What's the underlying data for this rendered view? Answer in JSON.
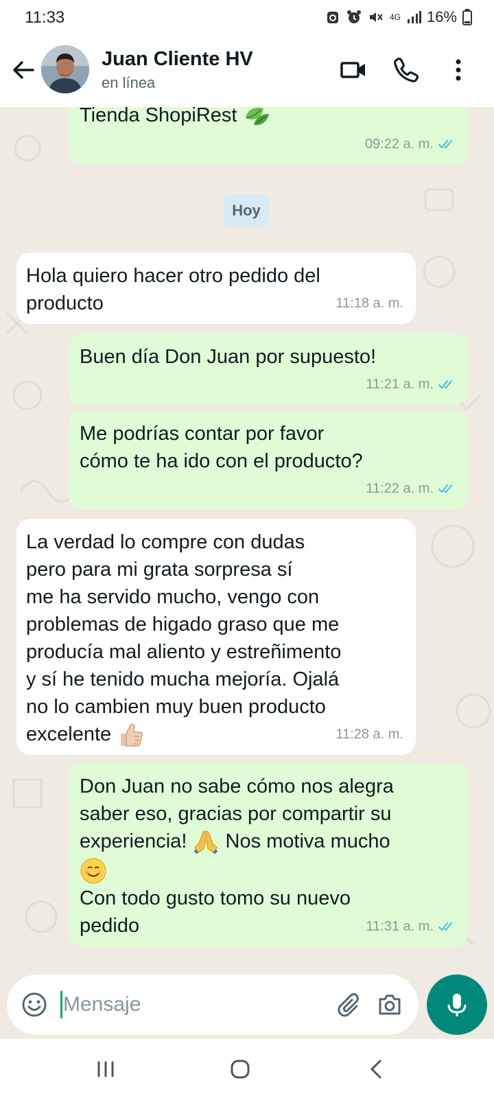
{
  "status_bar": {
    "time": "11:33",
    "network": "4G",
    "battery": "16%"
  },
  "header": {
    "contact_name": "Juan Cliente HV",
    "contact_status": "en línea",
    "icons": [
      "back-arrow-icon",
      "video-call-icon",
      "phone-icon",
      "more-options-icon"
    ]
  },
  "chat": {
    "day_separator": "Hoy",
    "messages": [
      {
        "direction": "out",
        "text": "Tienda ShopiRest",
        "emoji": "leaf",
        "time": "09:22 a. m.",
        "status": "read"
      },
      {
        "direction": "in",
        "text": "Hola quiero hacer otro pedido del\nproducto",
        "time": "11:18 a. m."
      },
      {
        "direction": "out",
        "text": "Buen día Don Juan por supuesto!",
        "time": "11:21 a. m.",
        "status": "read"
      },
      {
        "direction": "out",
        "text": "Me podrías contar por favor\ncómo te ha ido con el producto?",
        "time": "11:22 a. m.",
        "status": "read"
      },
      {
        "direction": "in",
        "text": "La verdad lo compre con dudas\npero para mi grata sorpresa sí\nme ha servido mucho, vengo con\nproblemas de higado graso que me\nproducía mal aliento y estreñimento\ny sí he tenido mucha mejoría. Ojalá\nno lo cambien muy buen producto\nexcelente",
        "emoji": "thumbs-up",
        "time": "11:28 a. m."
      },
      {
        "direction": "out",
        "text_part1": "Don Juan no sabe cómo nos alegra\nsaber eso, gracias por compartir su\nexperiencia! ",
        "emoji1": "folded-hands",
        "text_part2": " Nos motiva mucho",
        "emoji2": "smiling-face",
        "text_part3": "Con todo gusto tomo su nuevo\npedido",
        "time": "11:31 a. m.",
        "status": "read"
      }
    ]
  },
  "composer": {
    "placeholder": "Mensaje",
    "icons": [
      "emoji-icon",
      "attach-icon",
      "camera-icon",
      "mic-icon"
    ]
  },
  "colors": {
    "outgoing_bubble": "#e0fcd6",
    "incoming_bubble": "#ffffff",
    "chat_background": "#efeae2",
    "read_ticks": "#53bdeb",
    "accent": "#00897b"
  },
  "nav_bar": {
    "icons": [
      "recent-apps-icon",
      "home-icon",
      "back-icon"
    ]
  }
}
